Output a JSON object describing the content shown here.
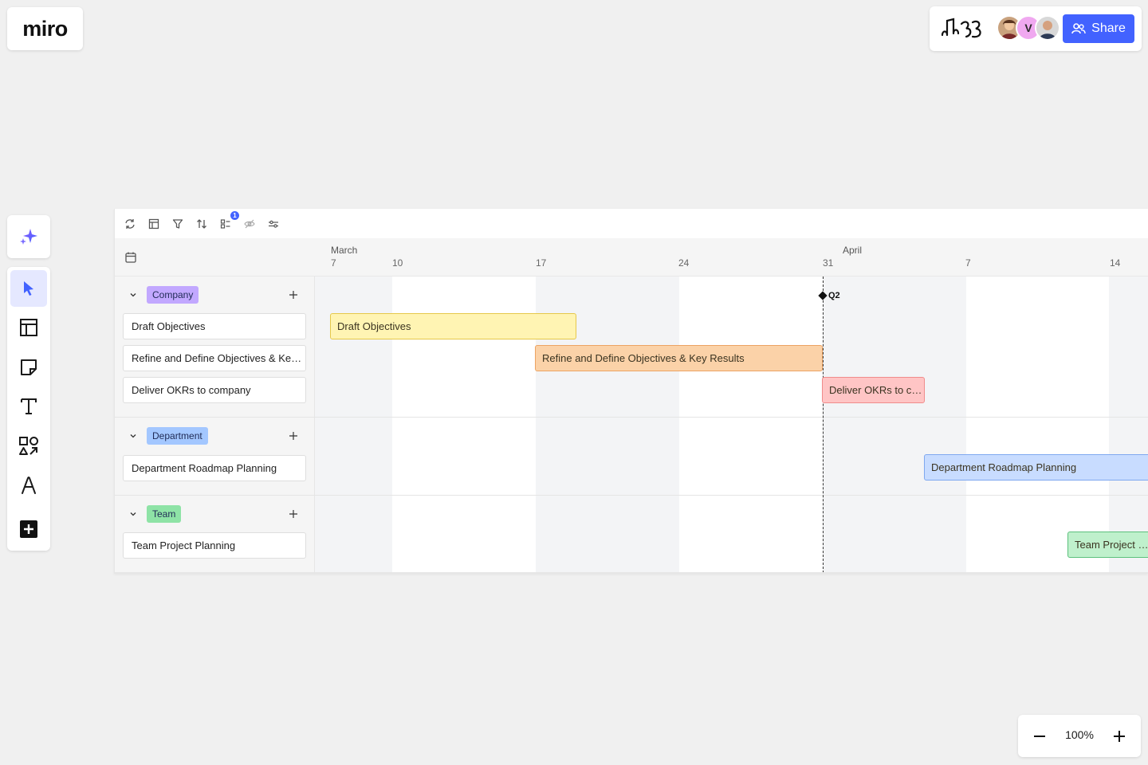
{
  "app": {
    "logo": "miro"
  },
  "top_bar": {
    "share_label": "Share",
    "avatars": [
      {
        "kind": "photo",
        "color": "#8a5a3c"
      },
      {
        "kind": "initial",
        "initial": "V",
        "color": "#f0a8f0"
      },
      {
        "kind": "photo",
        "color": "#a0a0a0"
      }
    ]
  },
  "left_toolbar": {
    "tools": [
      {
        "name": "select-tool",
        "icon": "cursor-icon",
        "active": true
      },
      {
        "name": "templates-tool",
        "icon": "layout-icon",
        "active": false
      },
      {
        "name": "sticky-note-tool",
        "icon": "sticky-note-icon",
        "active": false
      },
      {
        "name": "text-tool",
        "icon": "text-icon",
        "active": false
      },
      {
        "name": "shapes-tool",
        "icon": "shapes-icon",
        "active": false
      },
      {
        "name": "pen-tool",
        "icon": "pen-icon",
        "active": false
      },
      {
        "name": "more-tools",
        "icon": "plus-square-icon",
        "active": false
      }
    ]
  },
  "timeline": {
    "toolbar_badge": "1",
    "months": [
      {
        "label": "March"
      },
      {
        "label": "April"
      }
    ],
    "days": [
      "7",
      "10",
      "17",
      "24",
      "31",
      "7",
      "14"
    ],
    "milestone": "Q2",
    "groups": [
      {
        "label": "Company",
        "color": "#c2a8ff",
        "rows": [
          "Draft Objectives",
          "Refine and Define Objectives & Key Results",
          "Deliver OKRs to company"
        ]
      },
      {
        "label": "Department",
        "color": "#a3c7ff",
        "rows": [
          "Department Roadmap Planning"
        ]
      },
      {
        "label": "Team",
        "color": "#8ee3a6",
        "rows": [
          "Team Project Planning"
        ]
      }
    ],
    "bars": [
      {
        "label": "Draft Objectives",
        "start": "Mar 7",
        "end": "Mar 20",
        "fill": "#fff4b3",
        "border": "#e6c84a"
      },
      {
        "label": "Refine and Define Objectives & Key Results",
        "start": "Mar 17",
        "end": "Mar 31",
        "fill": "#fbd2a8",
        "border": "#eca363"
      },
      {
        "label": "Deliver OKRs to company",
        "start": "Mar 31",
        "end": "Apr 4",
        "fill": "#ffc5c5",
        "border": "#f08b8b"
      },
      {
        "label": "Department Roadmap Planning",
        "start": "Apr 4",
        "end": "Apr 14+",
        "fill": "#c8dcff",
        "border": "#7fa8ef"
      },
      {
        "label": "Team Project Planning",
        "start": "Apr 11",
        "end": "Apr 14+",
        "fill": "#bff0cc",
        "border": "#5cc07c"
      }
    ]
  },
  "zoom": {
    "level": "100%"
  }
}
